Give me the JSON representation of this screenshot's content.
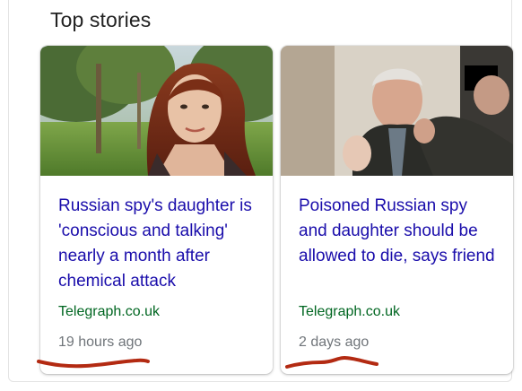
{
  "section": {
    "title": "Top stories"
  },
  "stories": [
    {
      "headline": "Russian spy's daughter is 'conscious and talking' nearly a month after chemical attack",
      "source": "Telegraph.co.uk",
      "time": "19 hours ago",
      "thumbnail": "photo-woman-red-hair-park"
    },
    {
      "headline": "Poisoned Russian spy and daughter should be allowed to die, says friend",
      "source": "Telegraph.co.uk",
      "time": "2 days ago",
      "thumbnail": "photo-man-in-dark-coat-redacted-face"
    }
  ],
  "colors": {
    "headline": "#1a0dab",
    "source": "#006621",
    "time": "#70757a",
    "annotation": "#b32a12"
  }
}
